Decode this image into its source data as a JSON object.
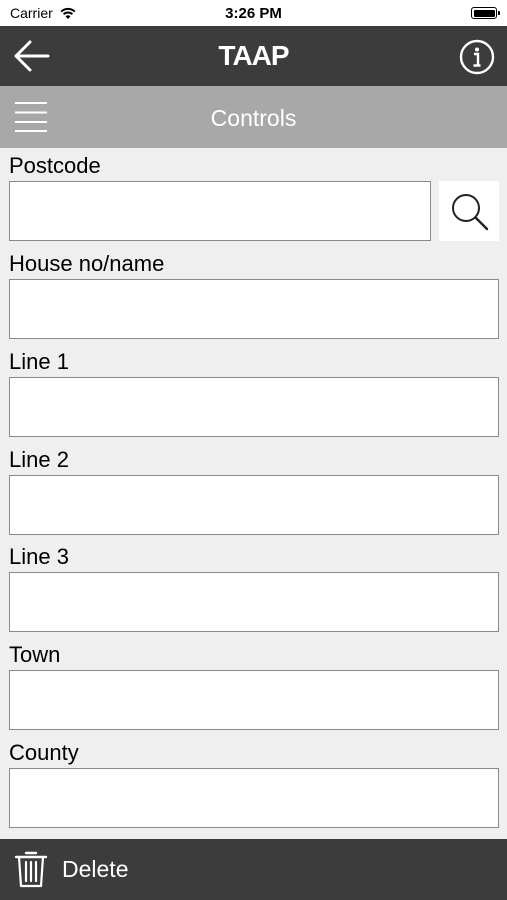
{
  "status": {
    "carrier": "Carrier",
    "time": "3:26 PM"
  },
  "navbar": {
    "title": "TAAP"
  },
  "subbar": {
    "title": "Controls"
  },
  "form": {
    "postcode_label": "Postcode",
    "house_label": "House no/name",
    "line1_label": "Line 1",
    "line2_label": "Line 2",
    "line3_label": "Line 3",
    "town_label": "Town",
    "county_label": "County",
    "postcode_value": "",
    "house_value": "",
    "line1_value": "",
    "line2_value": "",
    "line3_value": "",
    "town_value": "",
    "county_value": ""
  },
  "toolbar": {
    "delete_label": "Delete"
  },
  "icons": {
    "back": "arrow-left-icon",
    "info": "info-icon",
    "menu": "hamburger-menu-icon",
    "search": "search-icon",
    "delete": "trash-icon",
    "wifi": "wifi-icon",
    "battery": "battery-icon"
  },
  "colors": {
    "navbar": "#3c3c3c",
    "subbar": "#a8a8a8",
    "background": "#efefef"
  }
}
